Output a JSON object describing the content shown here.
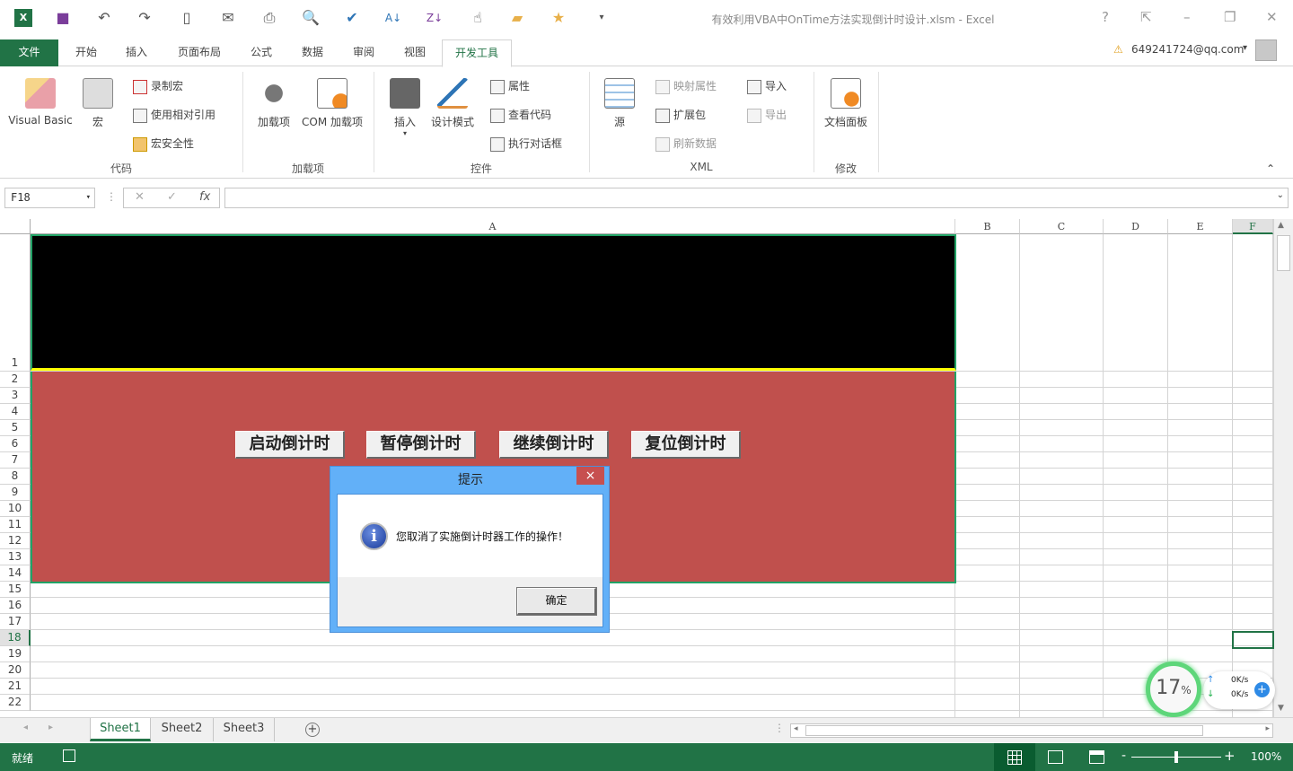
{
  "window": {
    "title": "有效利用VBA中OnTime方法实现倒计时设计.xlsm - Excel",
    "help": "?",
    "minimize": "–",
    "restore": "❐",
    "close": "✕",
    "ribbon_display": "⇱"
  },
  "qat": {
    "icons": [
      "excel-logo",
      "save",
      "undo",
      "redo",
      "new",
      "attach",
      "print-preview",
      "print-preview-zoom",
      "spelling",
      "sort-az",
      "sort-za",
      "touch-mode",
      "open-folder",
      "favorites-folder",
      "customize"
    ]
  },
  "tabs": [
    {
      "label": "文件"
    },
    {
      "label": "开始"
    },
    {
      "label": "插入"
    },
    {
      "label": "页面布局"
    },
    {
      "label": "公式"
    },
    {
      "label": "数据"
    },
    {
      "label": "审阅"
    },
    {
      "label": "视图"
    },
    {
      "label": "开发工具"
    }
  ],
  "account": {
    "email": "649241724@qq.com",
    "caret": "▾",
    "warning": "⚠"
  },
  "ribbon": {
    "code": {
      "label": "代码",
      "visual_basic": "Visual Basic",
      "macros": "宏",
      "record": "录制宏",
      "relative": "使用相对引用",
      "security": "宏安全性"
    },
    "addins": {
      "label": "加载项",
      "addins": "加载项",
      "com": "COM 加载项"
    },
    "controls": {
      "label": "控件",
      "insert": "插入",
      "design": "设计模式",
      "properties": "属性",
      "view_code": "查看代码",
      "run_dialog": "执行对话框",
      "caret": "▾"
    },
    "xml": {
      "label": "XML",
      "source": "源",
      "map_props": "映射属性",
      "expansion": "扩展包",
      "refresh": "刷新数据",
      "import": "导入",
      "export": "导出"
    },
    "modify": {
      "label": "修改",
      "doc_panel": "文档面板"
    },
    "collapse": "⌃"
  },
  "formula_bar": {
    "name_box": "F18",
    "cancel": "✕",
    "enter": "✓",
    "fx": "fx",
    "value": ""
  },
  "columns": [
    "A",
    "B",
    "C",
    "D",
    "E",
    "F"
  ],
  "rows": [
    "1",
    "2",
    "3",
    "4",
    "5",
    "6",
    "7",
    "8",
    "9",
    "10",
    "11",
    "12",
    "13",
    "14",
    "15",
    "16",
    "17",
    "18",
    "19",
    "20",
    "21",
    "22"
  ],
  "buttons": {
    "start": "启动倒计时",
    "pause": "暂停倒计时",
    "resume": "继续倒计时",
    "reset": "复位倒计时"
  },
  "dialog": {
    "title": "提示",
    "message": "您取消了实施倒计时器工作的操作！",
    "ok": "确定",
    "close": "×"
  },
  "sheets": [
    "Sheet1",
    "Sheet2",
    "Sheet3"
  ],
  "add_sheet": "+",
  "status": {
    "ready": "就绪",
    "zoom": "100%",
    "minus": "-",
    "plus": "+",
    "zoom_fraction": 0.5
  },
  "net_widget": {
    "cpu": "17",
    "pct": "%",
    "up": "0K/s",
    "down": "0K/s"
  },
  "colors": {
    "accent": "#217346",
    "black_band": "#000000",
    "red_band": "#c0504d",
    "yellow_line": "#ffff00",
    "dialog": "#62b0f8"
  }
}
